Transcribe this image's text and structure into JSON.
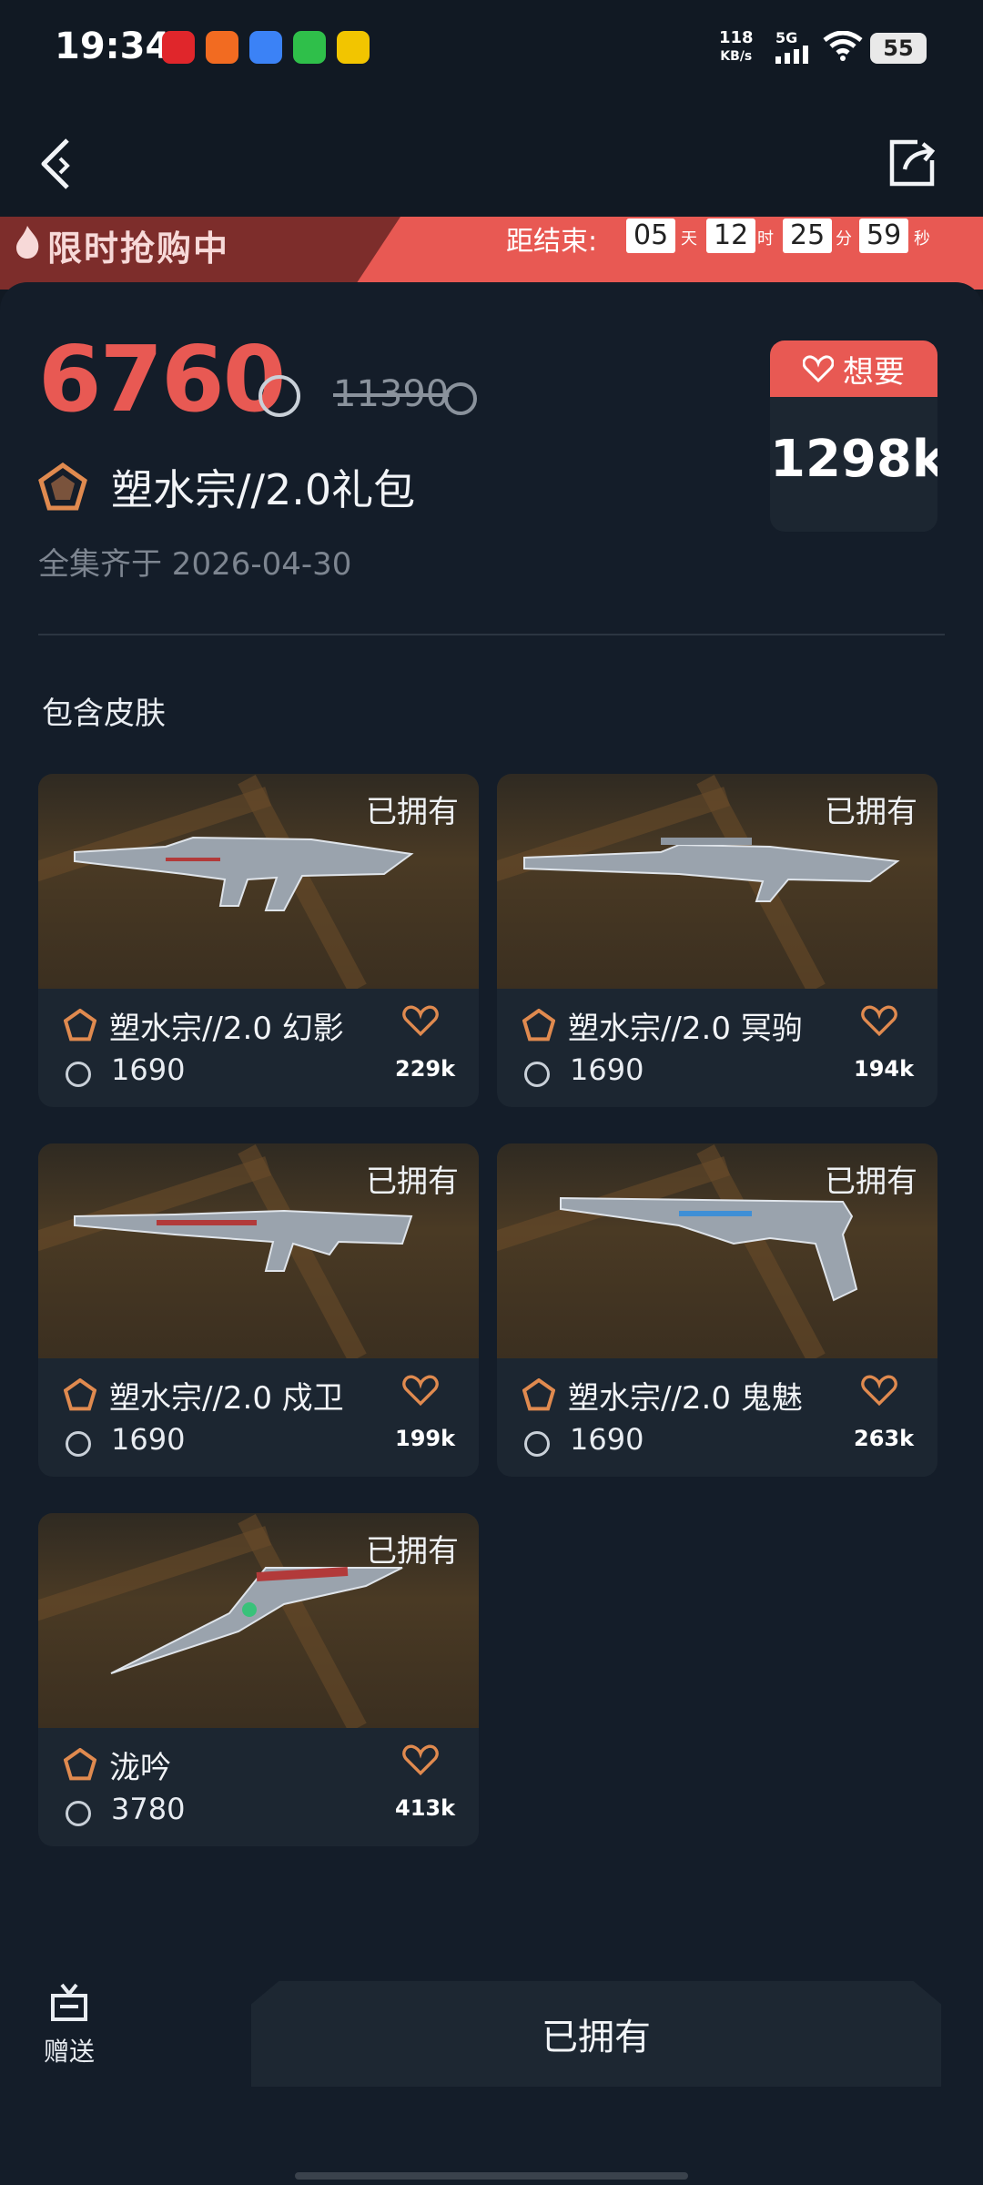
{
  "status_bar": {
    "time": "19:34",
    "net_speed": "118",
    "net_unit": "KB/s",
    "signal": "5G",
    "battery": "55",
    "app_icons": [
      {
        "name": "netease-music-icon",
        "color": "#e0262b"
      },
      {
        "name": "app-orange-icon",
        "color": "#f26b21"
      },
      {
        "name": "app-blue-icon",
        "color": "#3b82f6"
      },
      {
        "name": "wechat-icon",
        "color": "#2fbf4a"
      },
      {
        "name": "app-yellow-icon",
        "color": "#f2c500"
      }
    ]
  },
  "nav": {
    "back_icon": "chevron-left-icon",
    "share_icon": "share-icon"
  },
  "banner": {
    "title": "限时抢购中",
    "countdown_label": "距结束:",
    "days": "05",
    "days_unit": "天",
    "hours": "12",
    "hours_unit": "时",
    "minutes": "25",
    "minutes_unit": "分",
    "seconds": "59",
    "seconds_unit": "秒"
  },
  "bundle": {
    "price": "6760",
    "original_price": "11390",
    "name": "塑水宗//2.0礼包",
    "collect_text": "全集齐于 2026-04-30",
    "want_label": "想要",
    "want_count": "1298k"
  },
  "section_title": "包含皮肤",
  "skins": [
    {
      "name": "塑水宗//2.0 幻影",
      "cost": "1690",
      "likes": "229k",
      "owned": "已拥有"
    },
    {
      "name": "塑水宗//2.0 冥驹",
      "cost": "1690",
      "likes": "194k",
      "owned": "已拥有"
    },
    {
      "name": "塑水宗//2.0 戍卫",
      "cost": "1690",
      "likes": "199k",
      "owned": "已拥有"
    },
    {
      "name": "塑水宗//2.0 鬼魅",
      "cost": "1690",
      "likes": "263k",
      "owned": "已拥有"
    },
    {
      "name": "泷吟",
      "cost": "3780",
      "likes": "413k",
      "owned": "已拥有"
    }
  ],
  "bottom": {
    "gift_label": "赠送",
    "action_label": "已拥有"
  },
  "colors": {
    "accent": "#e85953",
    "tier": "#e08a4f",
    "bg": "#111923",
    "card": "#1c2631"
  }
}
